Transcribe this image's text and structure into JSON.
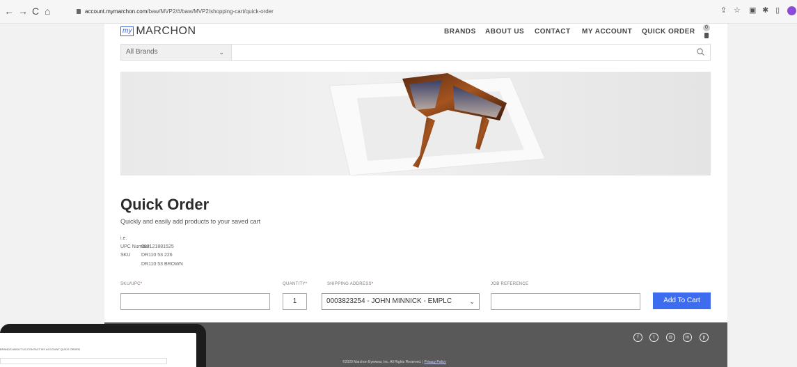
{
  "browser": {
    "nav": [
      "←",
      "→",
      "C",
      "⌂"
    ],
    "url_host": "account.mymarchon.com",
    "url_path": "/baw/MVP2/#/baw/MVP2/shopping-cart/quick-order",
    "ext_icons": [
      "share-icon",
      "star-icon",
      "extension-icon",
      "puzzle-icon",
      "sidebar-icon"
    ]
  },
  "header": {
    "logo_my": "my",
    "logo_brand": "MARCHON",
    "nav": [
      "BRANDS",
      "ABOUT US",
      "CONTACT",
      "MY ACCOUNT",
      "QUICK ORDER"
    ],
    "bag_count": "0"
  },
  "search": {
    "brand_select": "All Brands",
    "placeholder": ""
  },
  "quick_order": {
    "title": "Quick Order",
    "subtitle": "Quickly and easily add products to your saved cart",
    "example_intro": "i.e.",
    "upc_label": "UPC Number",
    "upc_value": "883121881525",
    "sku_label": "SKU",
    "sku_value_1": "DR110 53 226",
    "sku_value_2": "DR110 53 BROWN"
  },
  "form": {
    "sku_label": "SKU/UPC",
    "qty_label": "QUANTITY",
    "ship_label": "SHIPPING ADDRESS",
    "job_label": "JOB REFERENCE",
    "required_mark": "*",
    "sku_value": "",
    "qty_value": "1",
    "ship_value": "0003823254 - JOHN MINNICK - EMPLC",
    "job_value": "",
    "add_button": "Add To Cart"
  },
  "footer": {
    "copyright": "©2020 Marchon Eyewear, Inc. All Rights Reserved. |",
    "privacy": "Privacy Policy",
    "social": [
      "facebook-icon",
      "twitter-icon",
      "instagram-icon",
      "linkedin-icon",
      "pinterest-icon"
    ]
  },
  "overlay": {
    "mini_nav": "BRANDS   ABOUT US   CONTACT   MY ACCOUNT   QUICK ORDER"
  },
  "colors": {
    "accent": "#3d6dee",
    "footer": "#595959",
    "required": "#e03030"
  }
}
